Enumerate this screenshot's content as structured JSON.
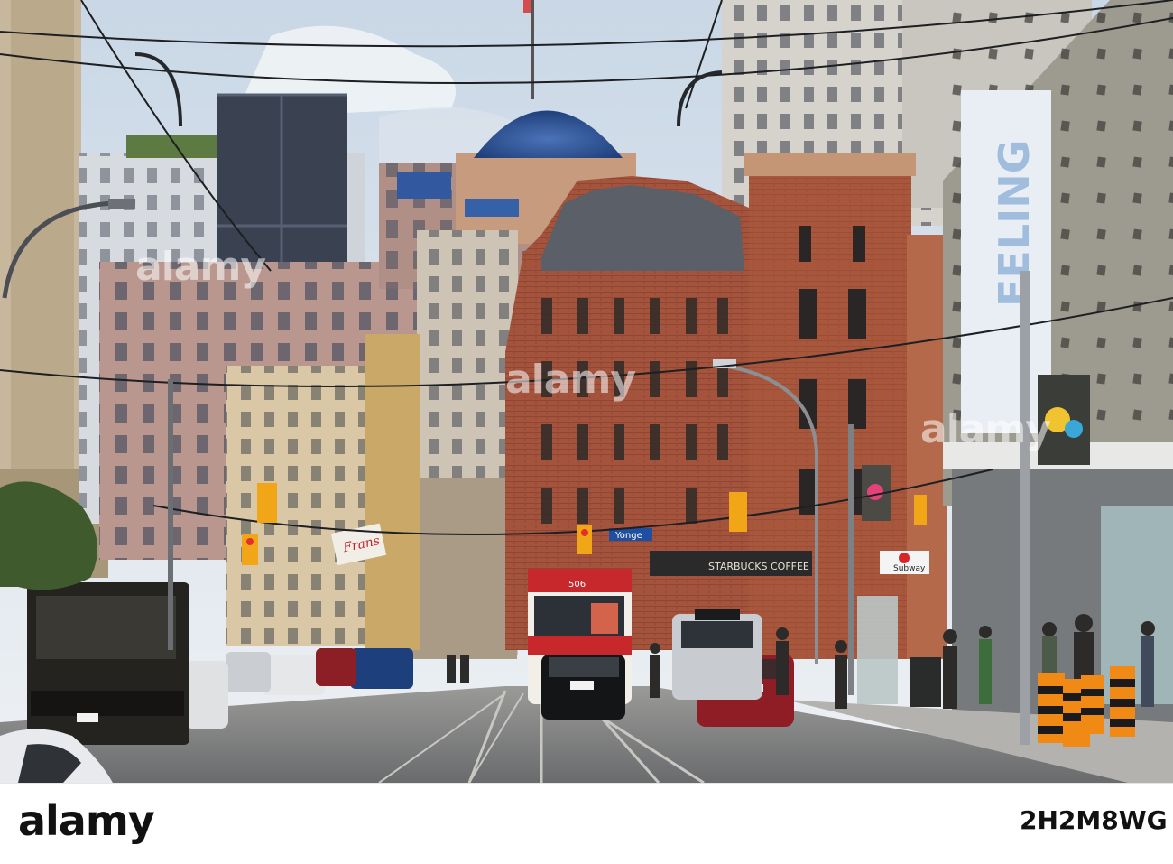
{
  "watermark": {
    "text": "alamy"
  },
  "footer": {
    "logo_text": "alamy",
    "image_id": "2H2M8WG"
  },
  "signs": {
    "frans": "Frans",
    "starbucks": "STARBUCKS COFFEE",
    "yonge": "Yonge",
    "subway": "Subway",
    "tram_route": "506",
    "billboard": "FELING"
  }
}
